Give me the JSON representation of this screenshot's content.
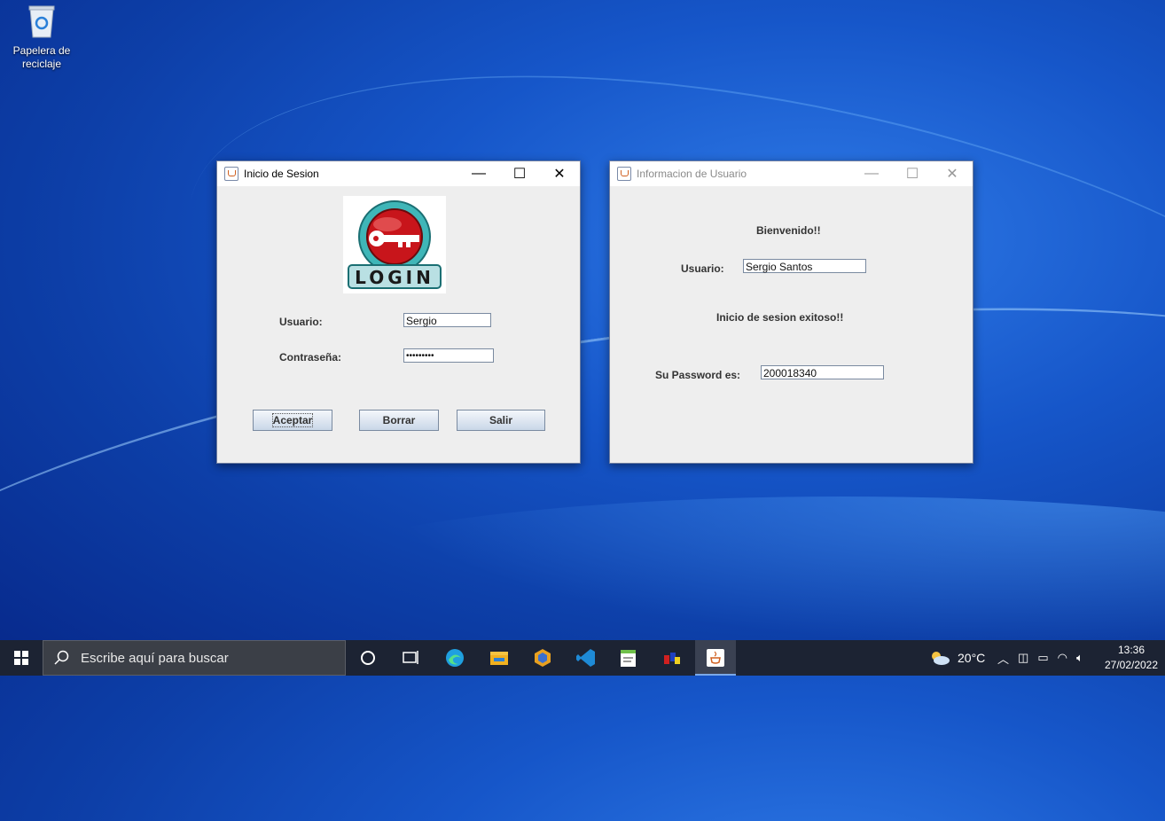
{
  "desktop": {
    "recycle_bin_label": "Papelera de reciclaje"
  },
  "login_window": {
    "title": "Inicio de Sesion",
    "logo_text": "LOGIN",
    "usuario_label": "Usuario:",
    "usuario_value": "Sergio",
    "password_label": "Contraseña:",
    "password_value": "•••••••••",
    "accept_button": "Aceptar",
    "clear_button": "Borrar",
    "exit_button": "Salir",
    "minimize": "—",
    "maximize": "☐",
    "close": "✕"
  },
  "info_window": {
    "title": "Informacion de Usuario",
    "welcome": "Bienvenido!!",
    "usuario_label": "Usuario:",
    "usuario_value": "Sergio Santos",
    "success_message": "Inicio de sesion exitoso!!",
    "password_label": "Su Password es:",
    "password_value": "200018340",
    "minimize": "—",
    "maximize": "☐",
    "close": "✕"
  },
  "taskbar": {
    "search_placeholder": "Escribe aquí para buscar",
    "weather": "20°C",
    "time": "13:36",
    "date": "27/02/2022"
  },
  "colors": {
    "desktop": "#1656c9",
    "taskbar": "#1c2333",
    "window_bg": "#eeeeee"
  }
}
